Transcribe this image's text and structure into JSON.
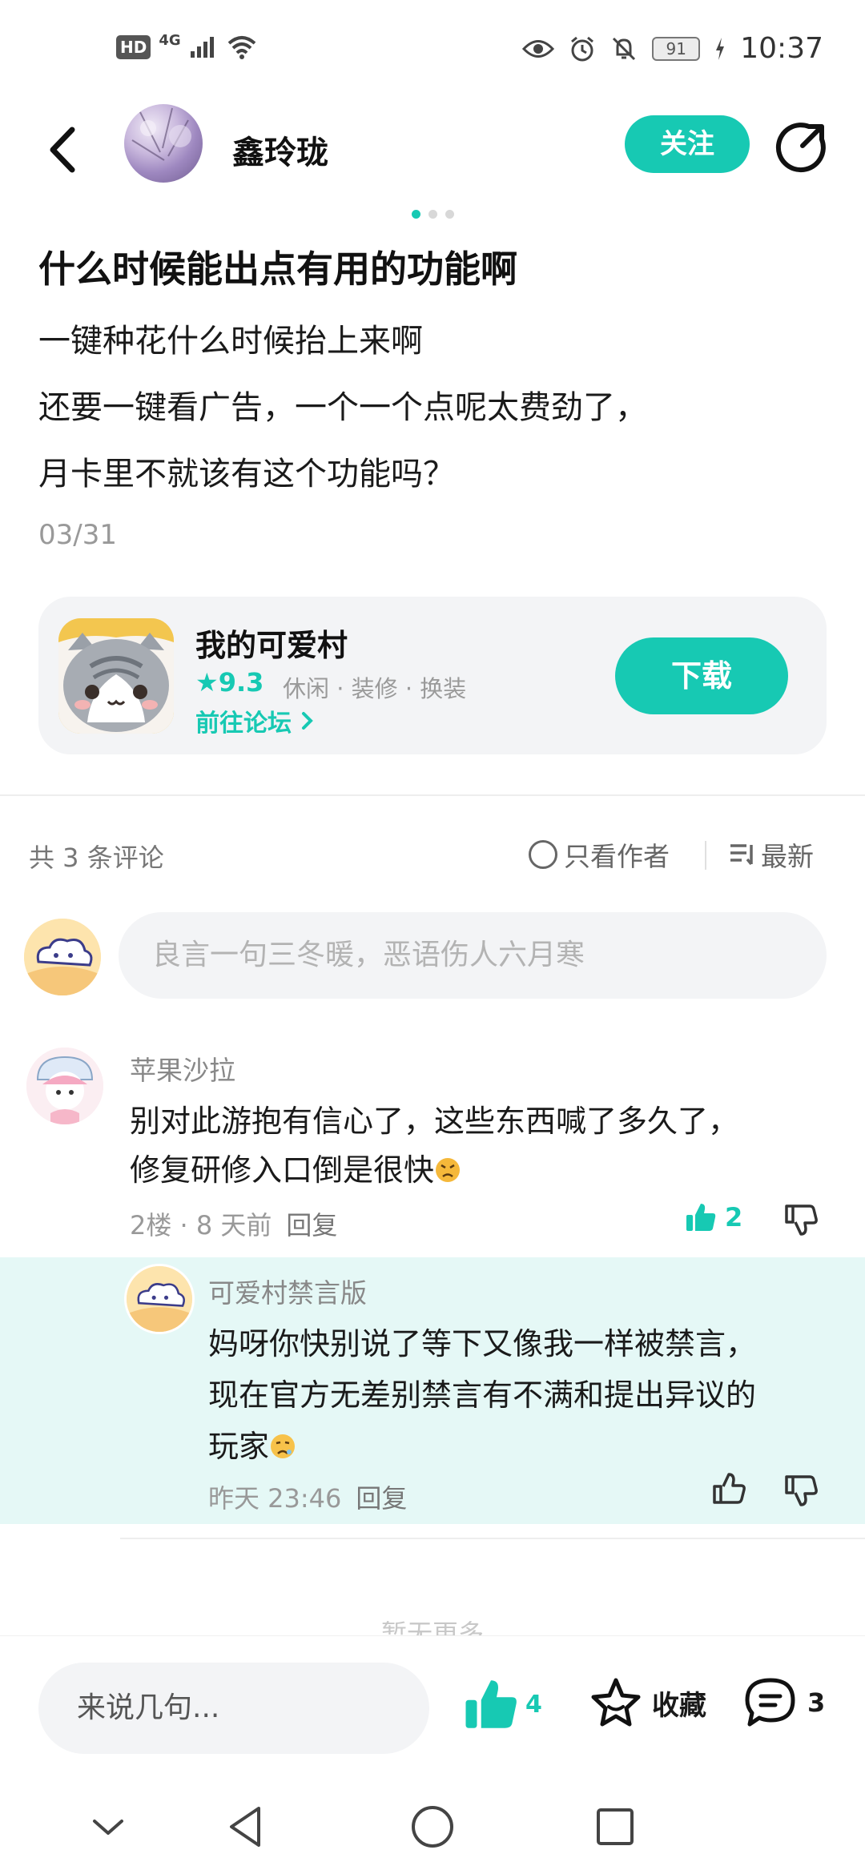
{
  "status_bar": {
    "hd": "HD",
    "network": "4G",
    "battery": "91",
    "time": "10:37"
  },
  "header": {
    "author": "鑫玲珑",
    "follow_label": "关注"
  },
  "post": {
    "title": "什么时候能出点有用的功能啊",
    "lines": [
      "一键种花什么时候抬上来啊",
      "还要一键看广告，一个一个点呢太费劲了，",
      "月卡里不就该有这个功能吗？"
    ],
    "date": "03/31"
  },
  "game_card": {
    "name": "我的可爱村",
    "rating": "9.3",
    "tags": "休闲 · 装修 · 换装",
    "forum_link": "前往论坛",
    "download_label": "下载"
  },
  "comments_header": {
    "count": "共 3 条评论",
    "only_author": "只看作者",
    "sort": "最新"
  },
  "comment_input": {
    "placeholder": "良言一句三冬暖，恶语伤人六月寒"
  },
  "comments": [
    {
      "user": "苹果沙拉",
      "text_line1": "别对此游抱有信心了，这些东西喊了多久了，",
      "text_line2": "修复研修入口倒是很快",
      "floor_time": "2楼 · 8 天前",
      "reply_label": "回复",
      "likes": "2"
    }
  ],
  "reply": {
    "user": "可爱村禁言版",
    "text_line1": "妈呀你快别说了等下又像我一样被禁言，",
    "text_line2": "现在官方无差别禁言有不满和提出异议的",
    "text_line3": "玩家",
    "time": "昨天 23:46",
    "reply_label": "回复"
  },
  "no_more": "暂无更多",
  "bottom_bar": {
    "input_placeholder": "来说几句...",
    "likes": "4",
    "favorite_label": "收藏",
    "comments": "3"
  },
  "colors": {
    "accent": "#17c9b3",
    "reply_bg": "#e5f8f6"
  }
}
